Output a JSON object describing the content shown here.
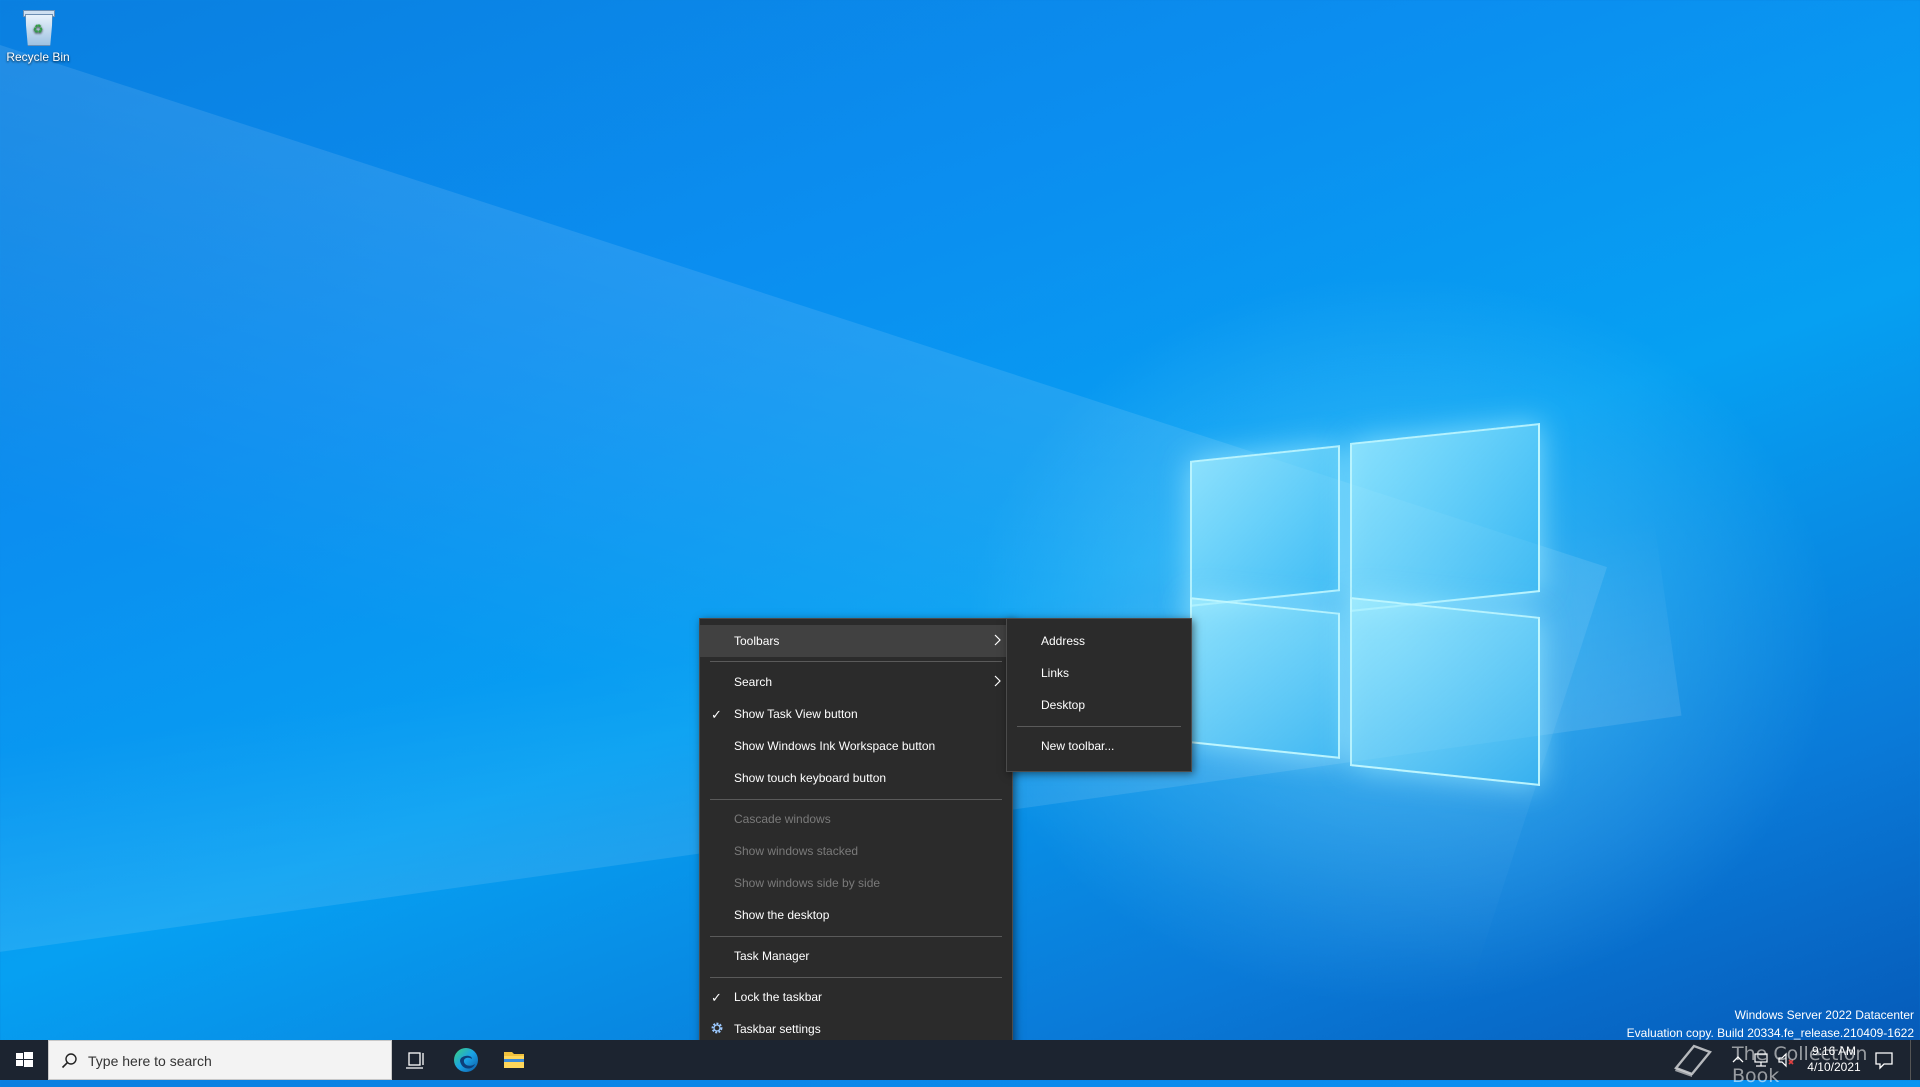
{
  "desktop": {
    "icons": [
      {
        "label": "Recycle Bin",
        "icon": "recycle-bin-icon"
      }
    ]
  },
  "context_menu": {
    "items": [
      {
        "label": "Toolbars",
        "submenu": true,
        "hover": true
      },
      {
        "label": "Search",
        "submenu": true
      },
      {
        "label": "Show Task View button",
        "checked": true
      },
      {
        "label": "Show Windows Ink Workspace button"
      },
      {
        "label": "Show touch keyboard button"
      },
      {
        "label": "Cascade windows",
        "disabled": true
      },
      {
        "label": "Show windows stacked",
        "disabled": true
      },
      {
        "label": "Show windows side by side",
        "disabled": true
      },
      {
        "label": "Show the desktop"
      },
      {
        "label": "Task Manager"
      },
      {
        "label": "Lock the taskbar",
        "checked": true
      },
      {
        "label": "Taskbar settings",
        "icon": "gear-icon"
      }
    ]
  },
  "toolbars_submenu": {
    "items": [
      {
        "label": "Address"
      },
      {
        "label": "Links"
      },
      {
        "label": "Desktop"
      },
      {
        "label": "New toolbar..."
      }
    ]
  },
  "taskbar": {
    "search_placeholder": "Type here to search",
    "pinned": [
      {
        "name": "task-view-icon"
      },
      {
        "name": "edge-icon"
      },
      {
        "name": "file-explorer-icon"
      }
    ],
    "clock": {
      "time": "9:16 AM",
      "date": "4/10/2021"
    }
  },
  "watermark": {
    "line1": "Windows Server 2022 Datacenter",
    "line2": "Evaluation copy. Build 20334.fe_release.210409-1622"
  },
  "overlay_watermark": {
    "text": "The Collection Book"
  }
}
